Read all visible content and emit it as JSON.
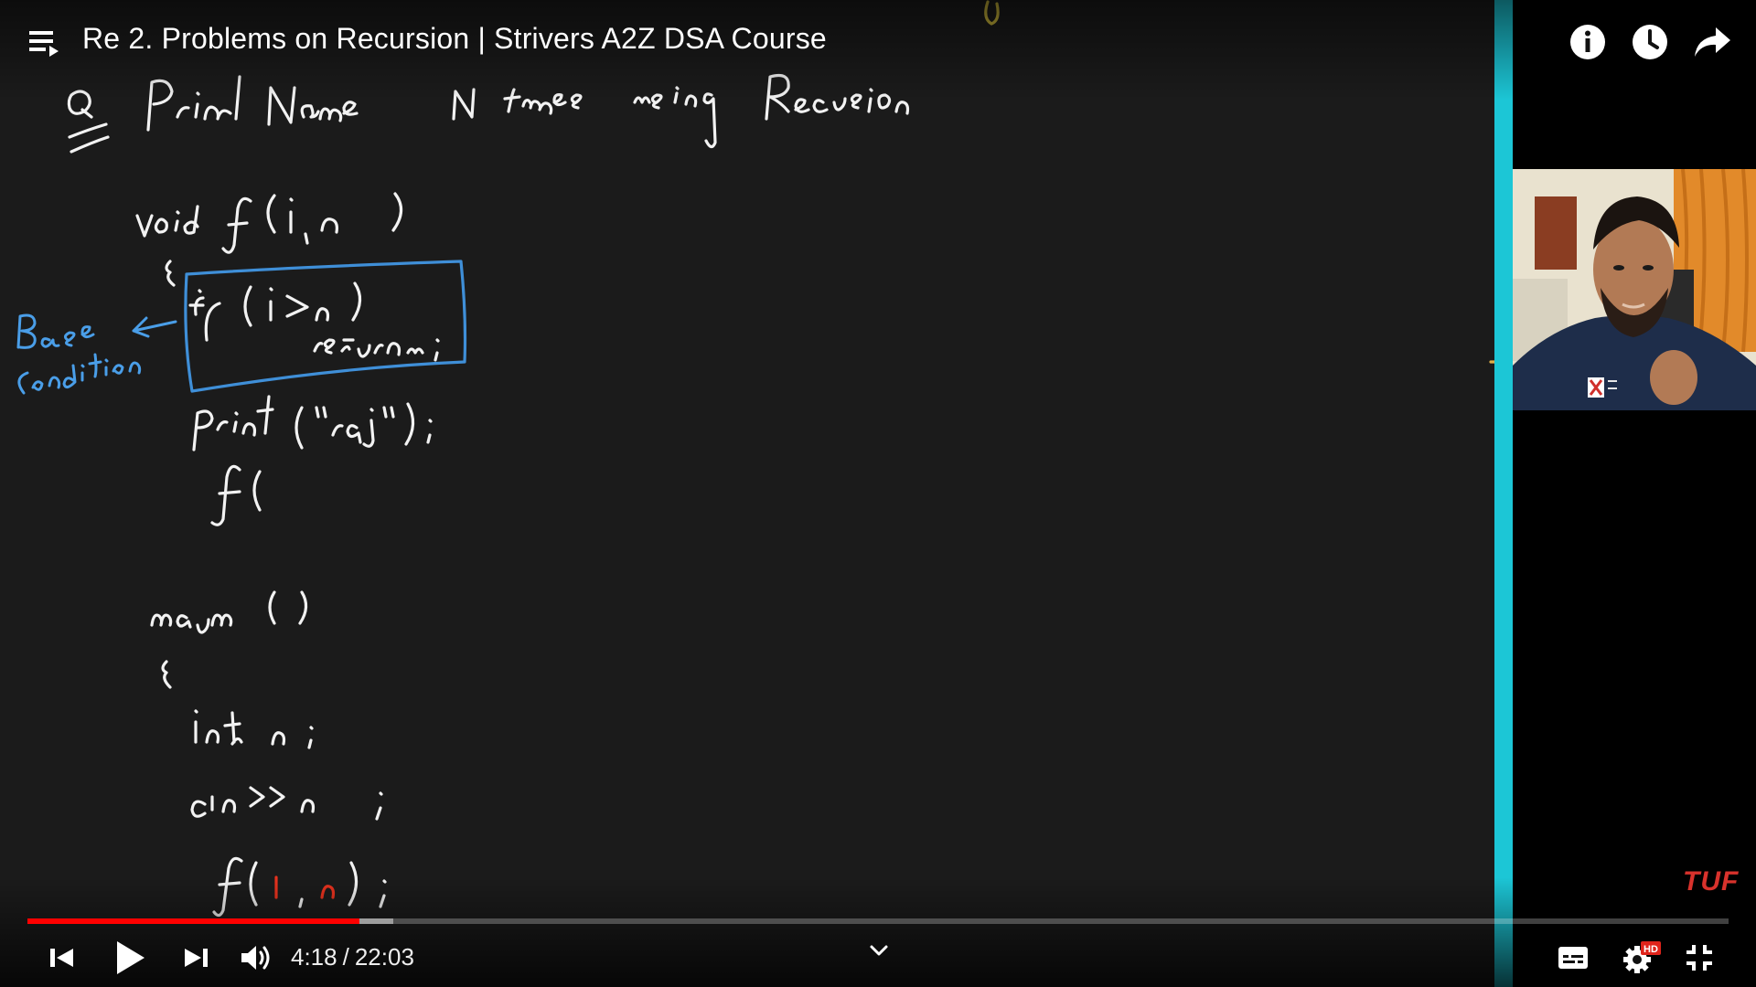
{
  "video": {
    "title": "Re 2. Problems on Recursion | Strivers A2Z DSA Course",
    "channel_logo": "TUF",
    "current_time": "4:18",
    "duration": "22:03",
    "time_separator": "/",
    "played_fraction": 0.195,
    "buffered_fraction": 0.215
  },
  "whiteboard": {
    "heading": "Q  Print Name   N  times  using  Recursion",
    "code_lines": [
      "void f(i, n)",
      "{",
      "if (i>n)",
      "return;",
      "print(\"raj\");",
      "f(",
      "main()",
      "{",
      "int n;",
      "cin >> n;",
      "f(1, n);"
    ],
    "annotation": [
      "Base",
      "Condition"
    ]
  },
  "icons": {
    "playlist": "playlist-icon",
    "info": "info-icon",
    "watch_later": "clock-icon",
    "share": "share-icon",
    "previous": "previous-icon",
    "play": "play-icon",
    "next": "next-icon",
    "volume": "volume-icon",
    "chapters": "chevron-down-icon",
    "subtitles": "subtitles-icon",
    "settings": "gear-icon",
    "exit_fullscreen": "exit-fullscreen-icon"
  },
  "badges": {
    "settings_quality": "HD"
  },
  "colors": {
    "accent": "#ff0000",
    "side_bar": "#1cc6d6",
    "chalk": "#f2f2f2",
    "annotation": "#4a9ee8",
    "logo": "#d8322c"
  }
}
